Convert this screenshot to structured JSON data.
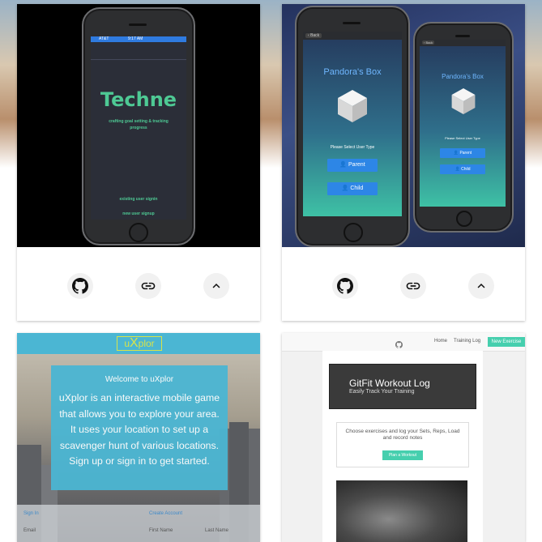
{
  "cards": [
    {
      "name": "techne",
      "title": "Techne",
      "subtitle": "crafting goal setting & tracking progress",
      "link1": "existing user signin",
      "link2": "new user signup",
      "status_left": "AT&T",
      "status_time": "9:17 AM"
    },
    {
      "name": "pandoras-box",
      "title": "Pandora's Box",
      "prompt": "Please Select User Type",
      "btn_parent": "Parent",
      "btn_child": "Child",
      "back_label": "Back"
    },
    {
      "name": "uxplor",
      "logo_left": "u",
      "logo_mid": "X",
      "logo_right": "plor",
      "welcome": "Welcome to uXplor",
      "description": "uXplor is an interactive mobile game that allows you to explore your area. It uses your location to set up a scavenger hunt of various locations. Sign up or sign in to get started.",
      "sign_in": "Sign In",
      "create_account": "Create Account",
      "email": "Email",
      "first_name": "First Name",
      "last_name": "Last Name"
    },
    {
      "name": "gitfit",
      "nav_home": "Home",
      "nav_training": "Training Log",
      "nav_new": "New Exercise",
      "title": "GitFit Workout Log",
      "tagline": "Easily Track Your Training",
      "choose": "Choose exercises and log your Sets, Reps, Load and record notes",
      "plan_btn": "Plan a Workout"
    }
  ],
  "icons": [
    "github-icon",
    "link-icon",
    "chevron-up-icon"
  ],
  "colors": {
    "techne_green": "#4ec994",
    "pandora_blue": "#2d86e6",
    "uxplor_blue": "#4bb6d3",
    "gitfit_teal": "#46cfae"
  }
}
